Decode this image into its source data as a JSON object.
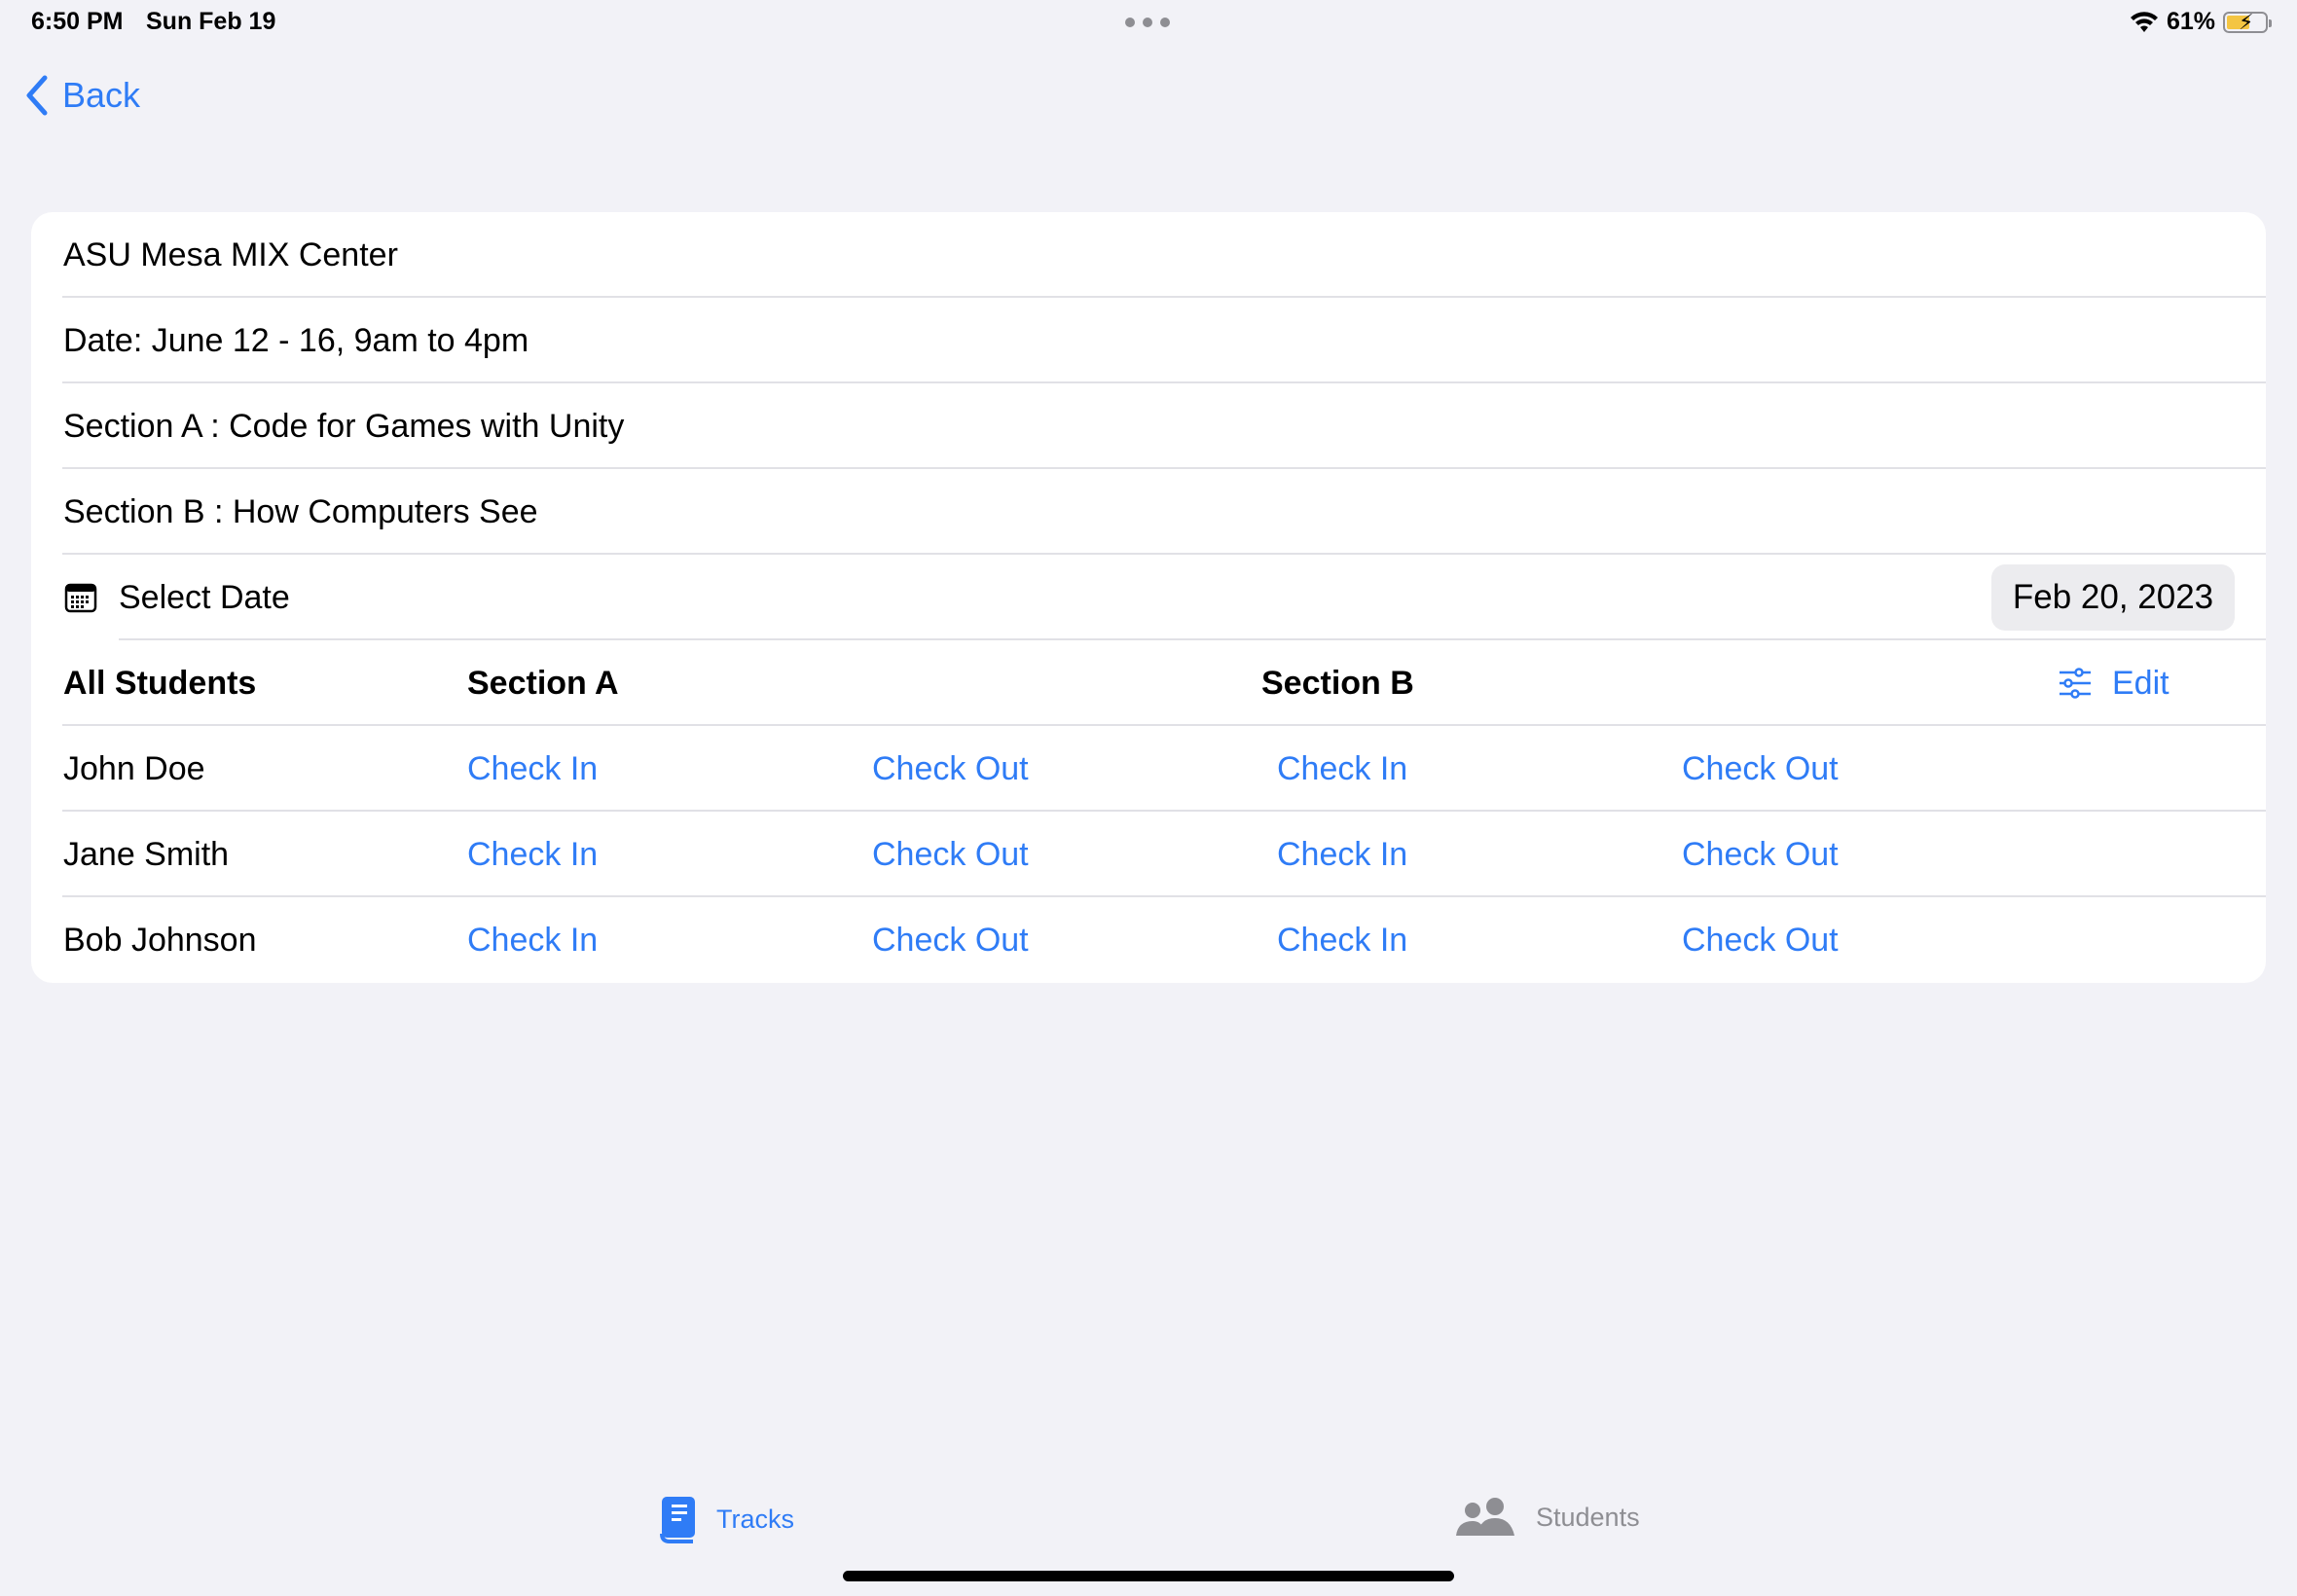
{
  "status": {
    "time": "6:50 PM",
    "date": "Sun Feb 19",
    "battery": "61%",
    "battery_level": 0.61
  },
  "nav": {
    "back_label": "Back"
  },
  "info": {
    "location": "ASU Mesa MIX Center",
    "date_text": "Date: June 12 - 16, 9am to 4pm",
    "section_a": "Section A :  Code for Games with Unity",
    "section_b": "Section B :  How Computers See"
  },
  "date_picker": {
    "label": "Select Date",
    "value": "Feb 20, 2023"
  },
  "table": {
    "headers": {
      "students": "All Students",
      "section_a": "Section A",
      "section_b": "Section B",
      "edit": "Edit"
    },
    "rows": [
      {
        "name": "John Doe",
        "a_in": "Check In",
        "a_out": "Check Out",
        "b_in": "Check In",
        "b_out": "Check Out"
      },
      {
        "name": "Jane Smith",
        "a_in": "Check In",
        "a_out": "Check Out",
        "b_in": "Check In",
        "b_out": "Check Out"
      },
      {
        "name": "Bob Johnson",
        "a_in": "Check In",
        "a_out": "Check Out",
        "b_in": "Check In",
        "b_out": "Check Out"
      }
    ]
  },
  "tabs": [
    {
      "label": "Tracks",
      "icon": "book-icon",
      "selected": true
    },
    {
      "label": "Students",
      "icon": "people-icon",
      "selected": false
    }
  ],
  "colors": {
    "accent": "#2f7cf6",
    "background": "#f2f2f7",
    "card": "#ffffff"
  }
}
